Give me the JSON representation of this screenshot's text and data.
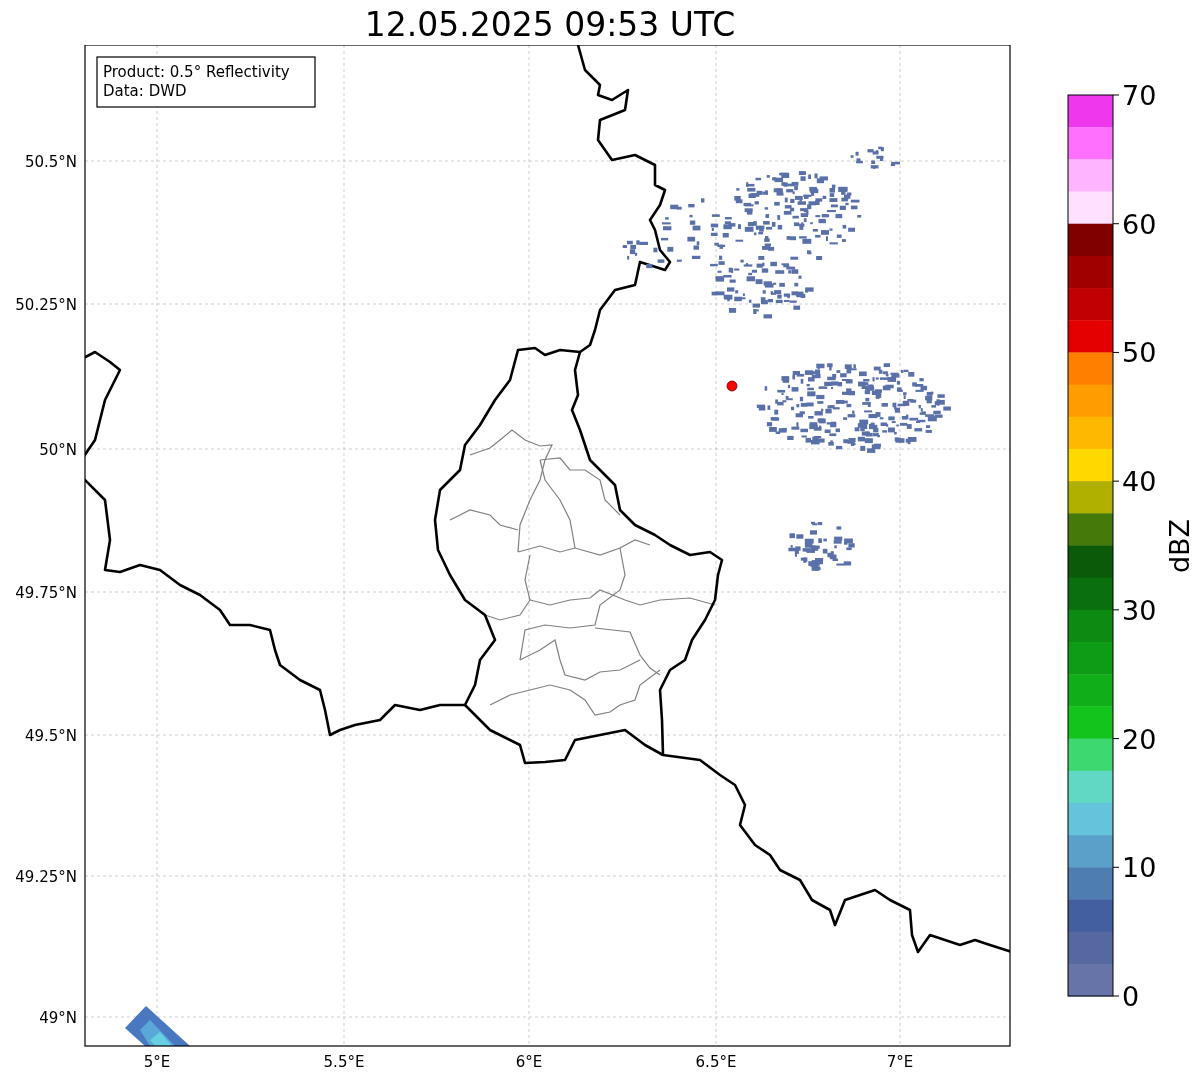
{
  "title": "12.05.2025 09:53 UTC",
  "legend": [
    "Product: 0.5° Reflectivity",
    "Data: DWD"
  ],
  "map": {
    "y_ticks": [
      "50.5°N",
      "50.25°N",
      "50°N",
      "49.75°N",
      "49.5°N",
      "49.25°N",
      "49°N"
    ],
    "x_ticks": [
      "5°E",
      "5.5°E",
      "6°E",
      "6.5°E",
      "7°E"
    ]
  },
  "colorbar": {
    "label": "dBZ",
    "ticks": [
      "70",
      "60",
      "50",
      "40",
      "30",
      "20",
      "10",
      "0"
    ],
    "bands": [
      {
        "color": "#ee38ee"
      },
      {
        "color": "#ff70ff"
      },
      {
        "color": "#ffb4ff"
      },
      {
        "color": "#ffe0ff"
      },
      {
        "color": "#800000"
      },
      {
        "color": "#a00000"
      },
      {
        "color": "#c00000"
      },
      {
        "color": "#e50000"
      },
      {
        "color": "#ff7f00"
      },
      {
        "color": "#ff9c00"
      },
      {
        "color": "#ffb800"
      },
      {
        "color": "#ffd800"
      },
      {
        "color": "#b0b000"
      },
      {
        "color": "#457a0a"
      },
      {
        "color": "#0a5a0a"
      },
      {
        "color": "#0a700e"
      },
      {
        "color": "#0c8a12"
      },
      {
        "color": "#0e9c16"
      },
      {
        "color": "#10ae18"
      },
      {
        "color": "#12c41c"
      },
      {
        "color": "#3ed870"
      },
      {
        "color": "#60d8c4"
      },
      {
        "color": "#64c4dc"
      },
      {
        "color": "#5aa0c8"
      },
      {
        "color": "#4e7db2"
      },
      {
        "color": "#445fa0"
      },
      {
        "color": "#5568a0"
      },
      {
        "color": "#6674a8"
      }
    ]
  }
}
